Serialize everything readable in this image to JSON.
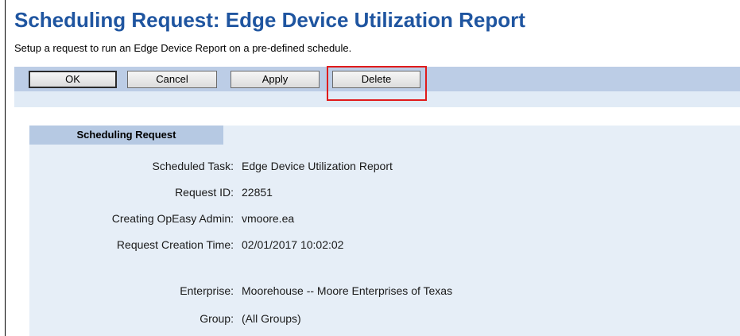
{
  "header": {
    "title": "Scheduling Request: Edge Device Utilization Report",
    "subtitle": "Setup a request to run an Edge Device Report on a pre-defined schedule."
  },
  "toolbar": {
    "ok_label": "OK",
    "cancel_label": "Cancel",
    "apply_label": "Apply",
    "delete_label": "Delete"
  },
  "section": {
    "header": "Scheduling Request",
    "fields": [
      {
        "label": "Scheduled Task:",
        "value": "Edge Device Utilization Report"
      },
      {
        "label": "Request ID:",
        "value": "22851"
      },
      {
        "label": "Creating OpEasy Admin:",
        "value": "vmoore.ea"
      },
      {
        "label": "Request Creation Time:",
        "value": "02/01/2017 10:02:02"
      },
      {
        "label": "Enterprise:",
        "value": "Moorehouse -- Moore Enterprises of Texas"
      },
      {
        "label": "Group:",
        "value": "(All Groups)"
      }
    ]
  },
  "colors": {
    "title": "#1f55a0",
    "toolbar": "#bccde6",
    "panel": "#e6eef7",
    "highlight": "#e01b1b"
  }
}
